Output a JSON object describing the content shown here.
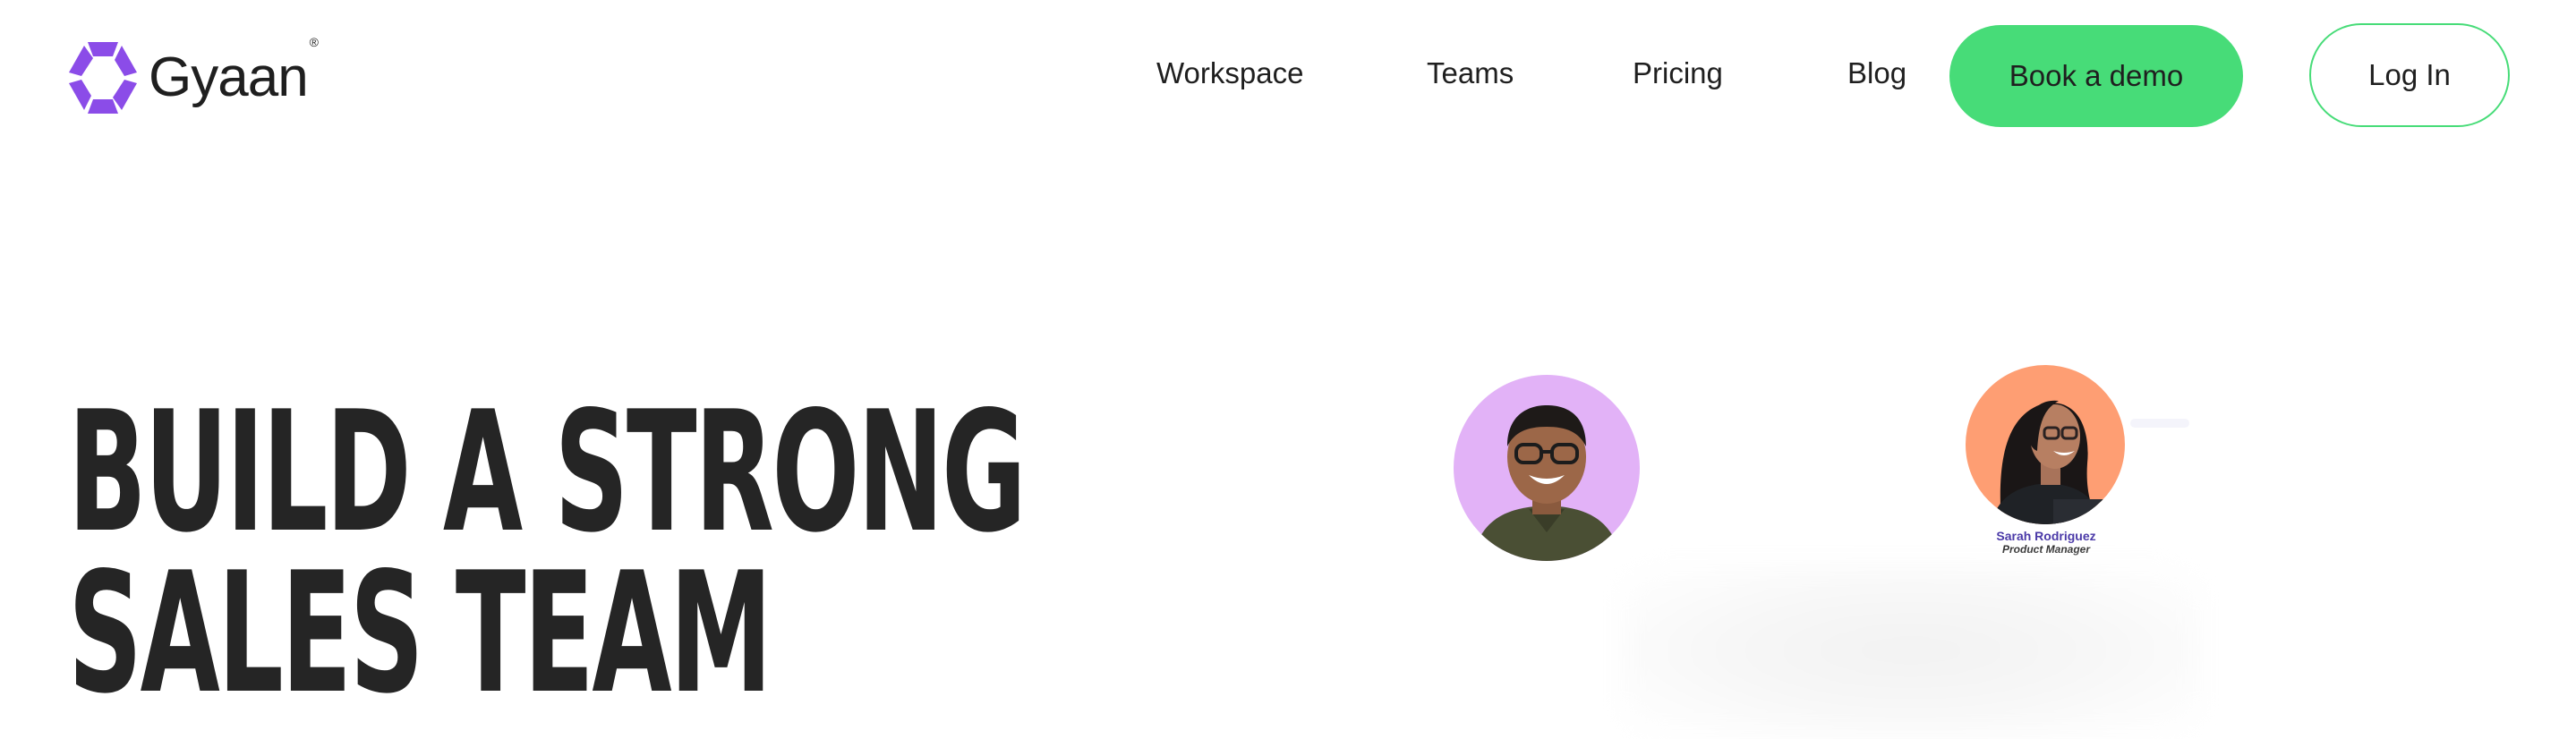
{
  "brand": {
    "name": "Gyaan",
    "registered_mark": "®",
    "logo_color": "#8b4ce8"
  },
  "nav": {
    "items": [
      {
        "label": "Workspace"
      },
      {
        "label": "Teams"
      },
      {
        "label": "Pricing"
      },
      {
        "label": "Blog"
      }
    ],
    "cta_label": "Book a demo",
    "login_label": "Log In",
    "cta_color": "#47dc78"
  },
  "hero": {
    "title_line_1": "BUILD A STRONG",
    "title_line_2": "SALES TEAM"
  },
  "people": [
    {
      "avatar_bg": "#e2b2f7"
    },
    {
      "name": "Sarah Rodriguez",
      "role": "Product Manager",
      "avatar_bg": "#fe9e73"
    }
  ]
}
